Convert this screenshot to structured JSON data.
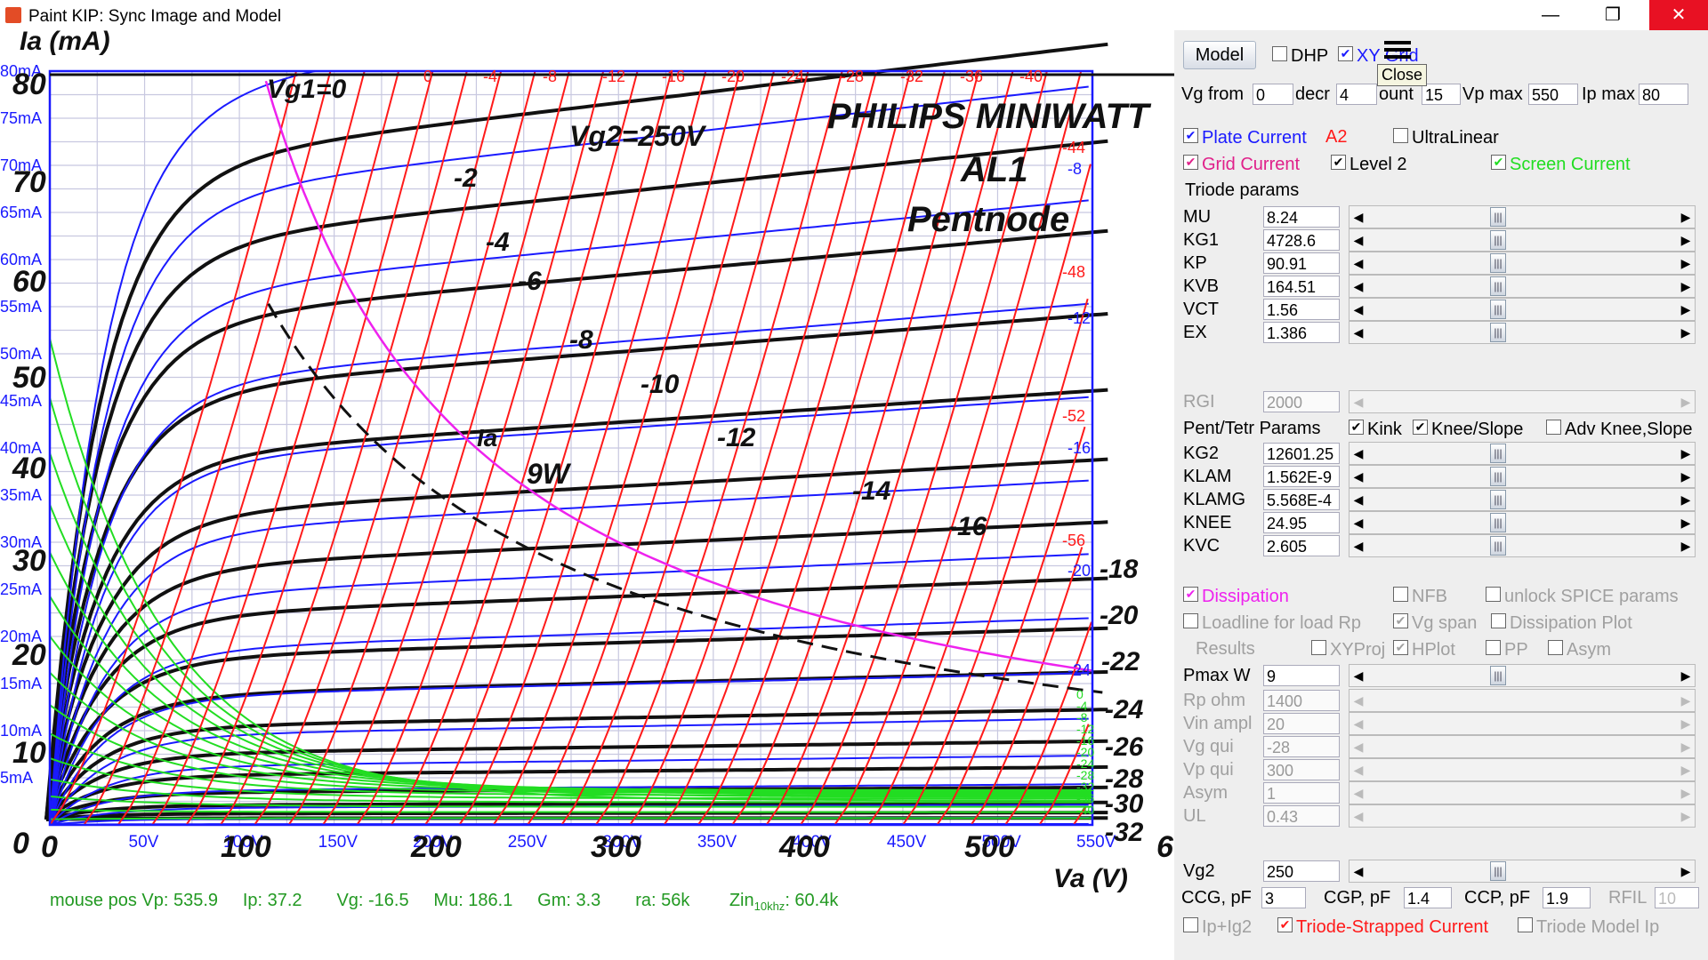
{
  "window": {
    "title": "Paint KIP: Sync Image and Model",
    "minimize": "—",
    "maximize": "❐",
    "close": "✕"
  },
  "plot": {
    "scan_labels": {
      "y_axis_title": "Ia (mA)",
      "x_axis_title": "Va (V)",
      "brand_line1": "PHILIPS MINIWATT",
      "brand_line2": "AL1",
      "brand_line3": "Pentnode",
      "vg2_label": "Vg2=250V",
      "vg1_zero": "Vg1=0",
      "ia_curve_label": "Ia",
      "dissipation_label": "9W",
      "scan_y_ticks": [
        "0",
        "10",
        "20",
        "30",
        "40",
        "50",
        "60",
        "70",
        "80"
      ],
      "scan_x_ticks": [
        "0",
        "100",
        "200",
        "300",
        "400",
        "500",
        "6"
      ],
      "scan_curve_labels": [
        "-2",
        "-4",
        "-6",
        "-8",
        "-10",
        "-12",
        "-14",
        "-16",
        "-18",
        "-20",
        "-22",
        "-24",
        "-26",
        "-28",
        "-30",
        "-32"
      ]
    },
    "model_y_ticks": [
      "5mA",
      "10mA",
      "15mA",
      "20mA",
      "25mA",
      "30mA",
      "35mA",
      "40mA",
      "45mA",
      "50mA",
      "55mA",
      "60mA",
      "65mA",
      "70mA",
      "75mA",
      "80mA"
    ],
    "model_x_ticks": [
      "50V",
      "100V",
      "150V",
      "200V",
      "250V",
      "300V",
      "350V",
      "400V",
      "450V",
      "500V",
      "550V"
    ],
    "grid_current_labels": [
      "0",
      "-4",
      "-8",
      "-12",
      "-16",
      "-20",
      "-24",
      "-28",
      "-32",
      "-36",
      "-40",
      "-44",
      "-48",
      "-52",
      "-56"
    ],
    "blue_curve_right_labels": [
      "-8",
      "-12",
      "-16",
      "-20",
      "-24"
    ],
    "green_right_labels": [
      "0",
      "-4",
      "-8",
      "-12",
      "-16",
      "-20",
      "-24",
      "-28",
      "-32",
      "-36",
      "-40"
    ],
    "status": {
      "vp": "mouse pos Vp: 535.9",
      "ip": "Ip: 37.2",
      "vg": "Vg: -16.5",
      "mu": "Mu: 186.1",
      "gm": "Gm: 3.3",
      "ra": "ra: 56k",
      "zin_prefix": "Zin",
      "zin_sub": "10khz",
      "zin_val": ": 60.4k"
    },
    "colors": {
      "blue": "#1a1aff",
      "red": "#ff1a1a",
      "green": "#22dd22",
      "magenta": "#ee22ee",
      "black": "#111111"
    }
  },
  "panel": {
    "model_button": "Model",
    "dhp": {
      "label": "DHP",
      "checked": false
    },
    "xy_grid": {
      "label": "XY Grid",
      "checked": true
    },
    "close_tooltip": "Close",
    "vg_from_label": "Vg from",
    "vg_from": "0",
    "decr_label": "decr",
    "decr": "4",
    "count_label": "ount",
    "count": "15",
    "vp_max_label": "Vp max",
    "vp_max": "550",
    "ip_max_label": "Ip max",
    "ip_max": "80",
    "plate_current": {
      "label": "Plate Current",
      "checked": true
    },
    "a2_label": "A2",
    "ultralinear": {
      "label": "UltraLinear",
      "checked": false
    },
    "grid_current": {
      "label": "Grid Current",
      "checked": true
    },
    "level2": {
      "label": "Level 2",
      "checked": true
    },
    "screen_current": {
      "label": "Screen Current",
      "checked": true
    },
    "triode_params_title": "Triode params",
    "triode_params": [
      {
        "label": "MU",
        "value": "8.24"
      },
      {
        "label": "KG1",
        "value": "4728.6"
      },
      {
        "label": "KP",
        "value": "90.91"
      },
      {
        "label": "KVB",
        "value": "164.51"
      },
      {
        "label": "VCT",
        "value": "1.56"
      },
      {
        "label": "EX",
        "value": "1.386"
      }
    ],
    "rgi": {
      "label": "RGI",
      "value": "2000"
    },
    "pent_params_title": "Pent/Tetr Params",
    "kink": {
      "label": "Kink",
      "checked": true
    },
    "knee_slope": {
      "label": "Knee/Slope",
      "checked": true
    },
    "adv_knee": {
      "label": "Adv Knee,Slope",
      "checked": false
    },
    "pent_params": [
      {
        "label": "KG2",
        "value": "12601.25"
      },
      {
        "label": "KLAM",
        "value": "1.562E-9"
      },
      {
        "label": "KLAMG",
        "value": "5.568E-4"
      },
      {
        "label": "KNEE",
        "value": "24.95"
      },
      {
        "label": "KVC",
        "value": "2.605"
      }
    ],
    "dissipation": {
      "label": "Dissipation",
      "checked": true
    },
    "nfb": {
      "label": "NFB",
      "checked": false
    },
    "unlock_spice": {
      "label": "unlock SPICE params",
      "checked": false
    },
    "loadline": {
      "label": "Loadline for load Rp",
      "checked": false
    },
    "vg_span": {
      "label": "Vg span",
      "checked": true
    },
    "dissipation_plot": {
      "label": "Dissipation Plot",
      "checked": false
    },
    "results_label": "Results",
    "xyproj": {
      "label": "XYProj",
      "checked": false
    },
    "hplot": {
      "label": "HPlot",
      "checked": true
    },
    "pp": {
      "label": "PP",
      "checked": false
    },
    "asym_chk": {
      "label": "Asym",
      "checked": false
    },
    "pmax": {
      "label": "Pmax W",
      "value": "9"
    },
    "disabled_params": [
      {
        "label": "Rp ohm",
        "value": "1400"
      },
      {
        "label": "Vin ampl",
        "value": "20"
      },
      {
        "label": "Vg qui",
        "value": "-28"
      },
      {
        "label": "Vp qui",
        "value": "300"
      },
      {
        "label": "Asym",
        "value": "1"
      },
      {
        "label": "UL",
        "value": "0.43"
      }
    ],
    "vg2": {
      "label": "Vg2",
      "value": "250"
    },
    "ccg_label": "CCG, pF",
    "ccg": "3",
    "cgp_label": "CGP, pF",
    "cgp": "1.4",
    "ccp_label": "CCP, pF",
    "ccp": "1.9",
    "rfil_label": "RFIL",
    "rfil": "10",
    "ip_ig2": {
      "label": "Ip+Ig2",
      "checked": false
    },
    "triode_strapped": {
      "label": "Triode-Strapped Current",
      "checked": true
    },
    "triode_model_ip": {
      "label": "Triode Model Ip",
      "checked": false
    }
  }
}
